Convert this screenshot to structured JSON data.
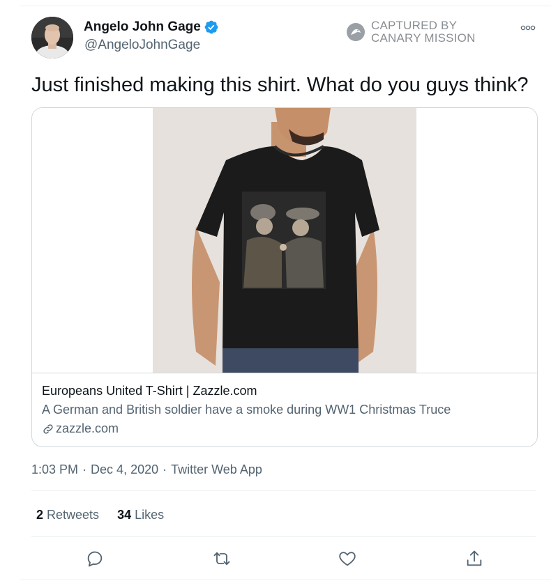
{
  "user": {
    "display_name": "Angelo John Gage",
    "handle": "@AngeloJohnGage",
    "verified": true
  },
  "watermark": {
    "line1": "CAPTURED BY",
    "line2": "CANARY MISSION"
  },
  "tweet": {
    "text": "Just finished making this shirt. What do you guys think?"
  },
  "card": {
    "title": "Europeans United T-Shirt | Zazzle.com",
    "description": "A German and British soldier have a smoke during WW1 Christmas Truce",
    "domain": "zazzle.com"
  },
  "meta": {
    "time": "1:03 PM",
    "date": "Dec 4, 2020",
    "source": "Twitter Web App"
  },
  "stats": {
    "retweets_count": "2",
    "retweets_label": "Retweets",
    "likes_count": "34",
    "likes_label": "Likes"
  },
  "colors": {
    "accent": "#1d9bf0",
    "text": "#0f1419",
    "secondary": "#536471",
    "border": "#cfd9de"
  },
  "icons": {
    "verified": "verified-badge-icon",
    "more": "more-options-icon",
    "link": "link-icon",
    "reply": "reply-icon",
    "retweet": "retweet-icon",
    "like": "heart-icon",
    "share": "share-icon"
  }
}
